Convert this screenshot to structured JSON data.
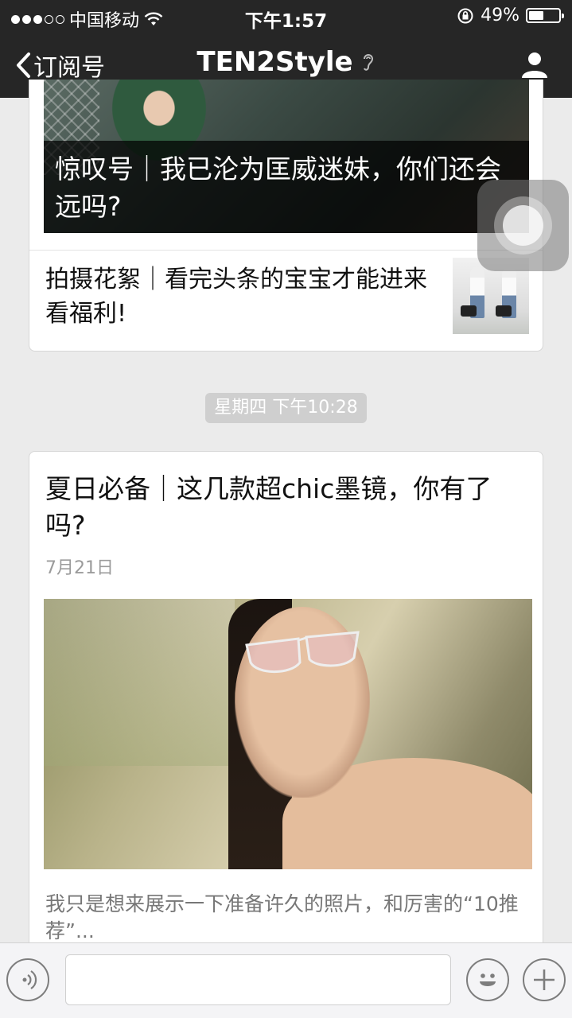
{
  "status_bar": {
    "carrier": "中国移动",
    "time": "下午1:57",
    "battery_percent_text": "49%",
    "battery_level": 0.49,
    "signal_bars_filled": 3,
    "signal_bars_total": 5
  },
  "navbar": {
    "back_label": "订阅号",
    "title": "TEN2Style",
    "icons": [
      "chevron-left-icon",
      "earpiece-icon",
      "user-icon"
    ]
  },
  "feed": {
    "card1": {
      "hero_overlay_title": "惊叹号｜我已沦为匡威迷妹，你们还会远吗?",
      "sub_article_title": "拍摄花絮｜看完头条的宝宝才能进来看福利!"
    },
    "timestamp": "星期四 下午10:28",
    "card2": {
      "title": "夏日必备｜这几款超chic墨镜，你有了吗?",
      "date": "7月21日",
      "excerpt": "我只是想来展示一下准备许久的照片，和厉害的“10推荐”..."
    }
  },
  "input_bar": {
    "icons": [
      "voice-icon",
      "emoji-icon",
      "plus-icon"
    ],
    "input_value": ""
  },
  "colors": {
    "nav_bg": "#262626",
    "page_bg": "#ebebeb",
    "card_bg": "#ffffff",
    "muted_text": "#9b9b9b",
    "time_pill_bg": "#cfcfcf"
  }
}
